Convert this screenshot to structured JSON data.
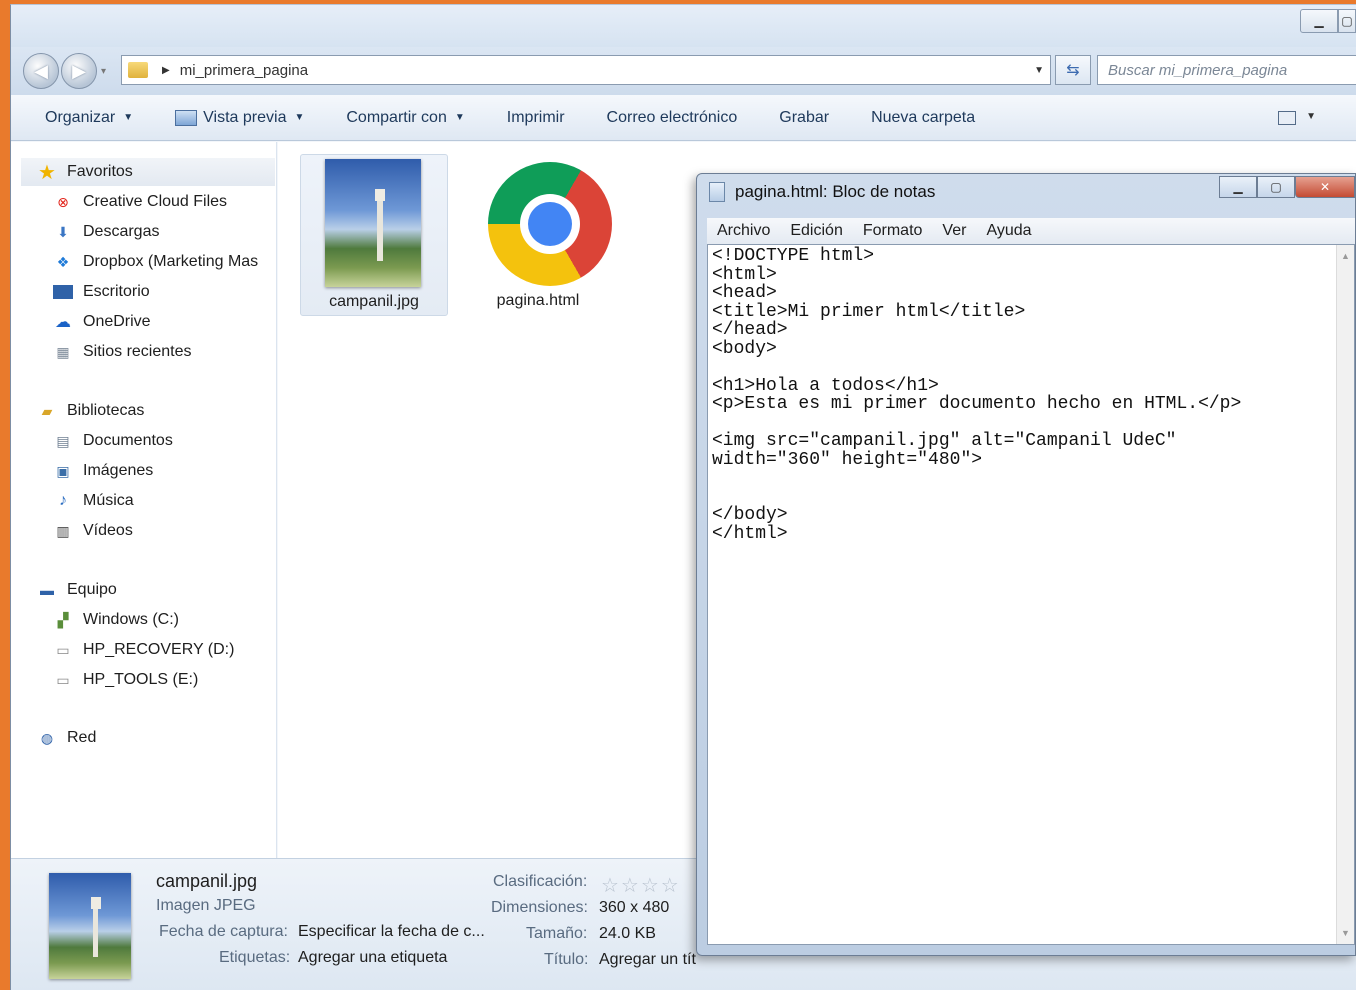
{
  "explorer": {
    "address": {
      "path": "mi_primera_pagina"
    },
    "search": {
      "placeholder": "Buscar mi_primera_pagina"
    },
    "toolbar": {
      "organize": "Organizar",
      "preview": "Vista previa",
      "share": "Compartir con",
      "print": "Imprimir",
      "email": "Correo electrónico",
      "burn": "Grabar",
      "new_folder": "Nueva carpeta"
    },
    "nav": {
      "favorites": "Favoritos",
      "creative_cloud": "Creative Cloud Files",
      "downloads": "Descargas",
      "dropbox": "Dropbox (Marketing Mas",
      "desktop": "Escritorio",
      "onedrive": "OneDrive",
      "recent": "Sitios recientes",
      "libraries": "Bibliotecas",
      "documents": "Documentos",
      "images": "Imágenes",
      "music": "Música",
      "videos": "Vídeos",
      "computer": "Equipo",
      "drive_c": "Windows  (C:)",
      "drive_d": "HP_RECOVERY (D:)",
      "drive_e": "HP_TOOLS (E:)",
      "network": "Red"
    },
    "files": {
      "image_name": "campanil.jpg",
      "html_name": "pagina.html"
    },
    "details": {
      "name": "campanil.jpg",
      "type": "Imagen JPEG",
      "date_label": "Fecha de captura:",
      "date_value": "Especificar la fecha de c...",
      "tags_label": "Etiquetas:",
      "tags_value": "Agregar una etiqueta",
      "rating_label": "Clasificación:",
      "dims_label": "Dimensiones:",
      "dims_value": "360 x 480",
      "size_label": "Tamaño:",
      "size_value": "24.0 KB",
      "title_label": "Título:",
      "title_value": "Agregar un tít"
    }
  },
  "notepad": {
    "title": "pagina.html: Bloc de notas",
    "menu": {
      "file": "Archivo",
      "edit": "Edición",
      "format": "Formato",
      "view": "Ver",
      "help": "Ayuda"
    },
    "content": "<!DOCTYPE html>\n<html>\n<head>\n<title>Mi primer html</title>\n</head>\n<body>\n\n<h1>Hola a todos</h1>\n<p>Esta es mi primer documento hecho en HTML.</p>\n\n<img src=\"campanil.jpg\" alt=\"Campanil UdeC\"\nwidth=\"360\" height=\"480\">\n\n\n</body>\n</html>"
  }
}
